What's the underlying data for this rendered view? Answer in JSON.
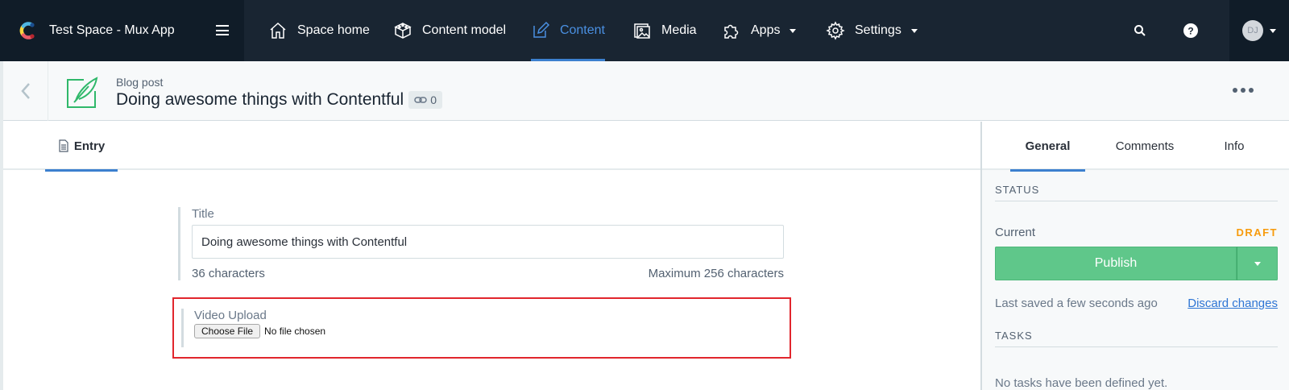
{
  "app": {
    "space_title": "Test Space - Mux App",
    "logo_icon": "contentful-logo-icon",
    "menu_icon": "hamburger-icon"
  },
  "nav": {
    "items": [
      {
        "label": "Space home",
        "icon": "house-icon",
        "active": false,
        "dropdown": false
      },
      {
        "label": "Content model",
        "icon": "box-icon",
        "active": false,
        "dropdown": false
      },
      {
        "label": "Content",
        "icon": "pencil-icon",
        "active": true,
        "dropdown": false
      },
      {
        "label": "Media",
        "icon": "image-icon",
        "active": false,
        "dropdown": false
      },
      {
        "label": "Apps",
        "icon": "puzzle-icon",
        "active": false,
        "dropdown": true
      },
      {
        "label": "Settings",
        "icon": "gear-icon",
        "active": false,
        "dropdown": true
      }
    ],
    "search_icon": "search-icon",
    "help_icon": "help-icon",
    "account_initials": "DJ"
  },
  "header": {
    "content_type": "Blog post",
    "entry_title": "Doing awesome things with Contentful",
    "links_count": "0"
  },
  "tabs": {
    "entry_label": "Entry"
  },
  "fields": {
    "title": {
      "label": "Title",
      "value": "Doing awesome things with Contentful",
      "char_count": "36 characters",
      "max_chars": "Maximum 256 characters"
    },
    "video_upload": {
      "label": "Video Upload",
      "button_label": "Choose File",
      "status": "No file chosen"
    }
  },
  "sidebar": {
    "tabs": [
      "General",
      "Comments",
      "Info"
    ],
    "active_tab": "General",
    "status_heading": "STATUS",
    "current_label": "Current",
    "status_value": "DRAFT",
    "publish_label": "Publish",
    "last_saved": "Last saved a few seconds ago",
    "discard_label": "Discard changes",
    "tasks_heading": "TASKS",
    "no_tasks": "No tasks have been defined yet."
  },
  "colors": {
    "nav_bg": "#192532",
    "accent": "#3c80cf",
    "publish_green": "#5fc78a",
    "draft_orange": "#f79b0c",
    "highlight_red": "#e1262d"
  }
}
